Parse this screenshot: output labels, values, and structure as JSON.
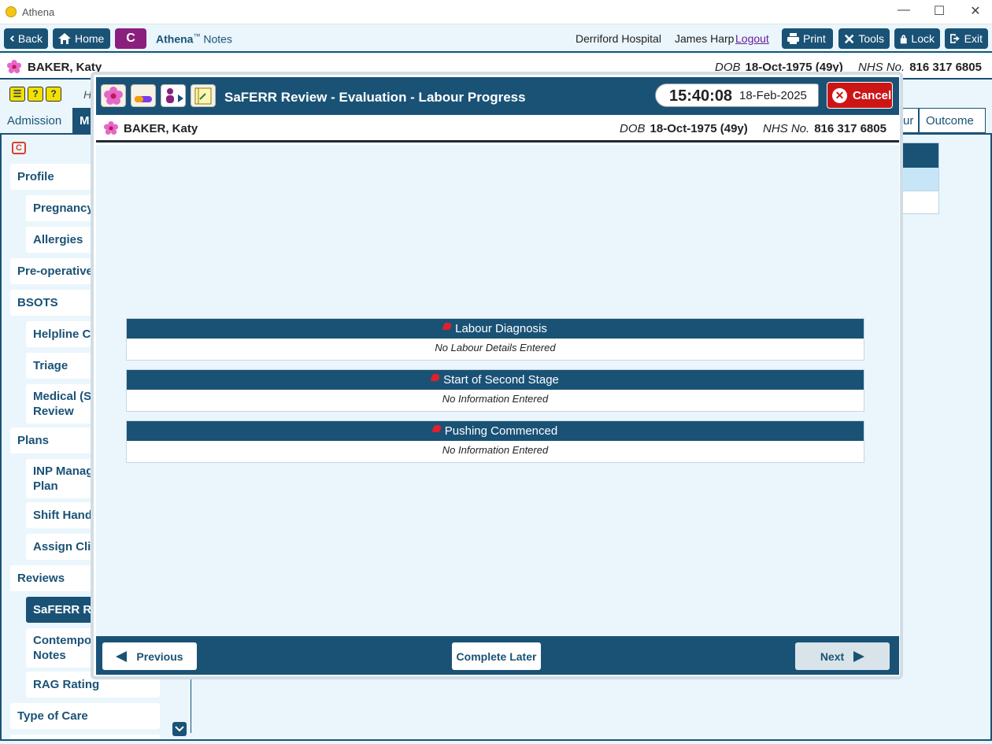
{
  "window": {
    "title": "Athena"
  },
  "toolbar": {
    "back": "Back",
    "home": "Home",
    "c_label": "C",
    "brand": "Athena",
    "brand_tm": "™",
    "brand_suffix": "Notes",
    "hospital": "Derriford Hospital",
    "user": "James Harp",
    "logout": "Logout",
    "print": "Print",
    "tools": "Tools",
    "lock": "Lock",
    "exit": "Exit"
  },
  "patient": {
    "name": "BAKER, Katy",
    "dob_label": "DOB",
    "dob": "18-Oct-1975 (49y)",
    "nhs_label": "NHS No.",
    "nhs": "816 317 6805"
  },
  "background": {
    "tabs": [
      "Admission",
      "M",
      "ur",
      "Outcome"
    ],
    "partial_h": "H"
  },
  "nav": {
    "items": [
      "Profile",
      "Pregnancy",
      "Allergies",
      "Pre-operative",
      "BSOTS",
      "Helpline Co",
      "Triage",
      "Medical (Sa",
      "Review",
      "Plans",
      "INP Manag",
      "Plan",
      "Shift Hando",
      "Assign Clin",
      "Reviews",
      "SaFERR Rev",
      "Contempor",
      "Notes",
      "RAG Rating",
      "Type of Care"
    ]
  },
  "modal": {
    "title": "SaFERR Review - Evaluation - Labour Progress",
    "time": "15:40:08",
    "date": "18-Feb-2025",
    "cancel": "Cancel",
    "sections": [
      {
        "title": "Labour Diagnosis",
        "text": "No Labour Details Entered"
      },
      {
        "title": "Start of Second Stage",
        "text": "No Information Entered"
      },
      {
        "title": "Pushing Commenced",
        "text": "No Information Entered"
      }
    ],
    "previous": "Previous",
    "complete_later": "Complete Later",
    "next": "Next"
  }
}
